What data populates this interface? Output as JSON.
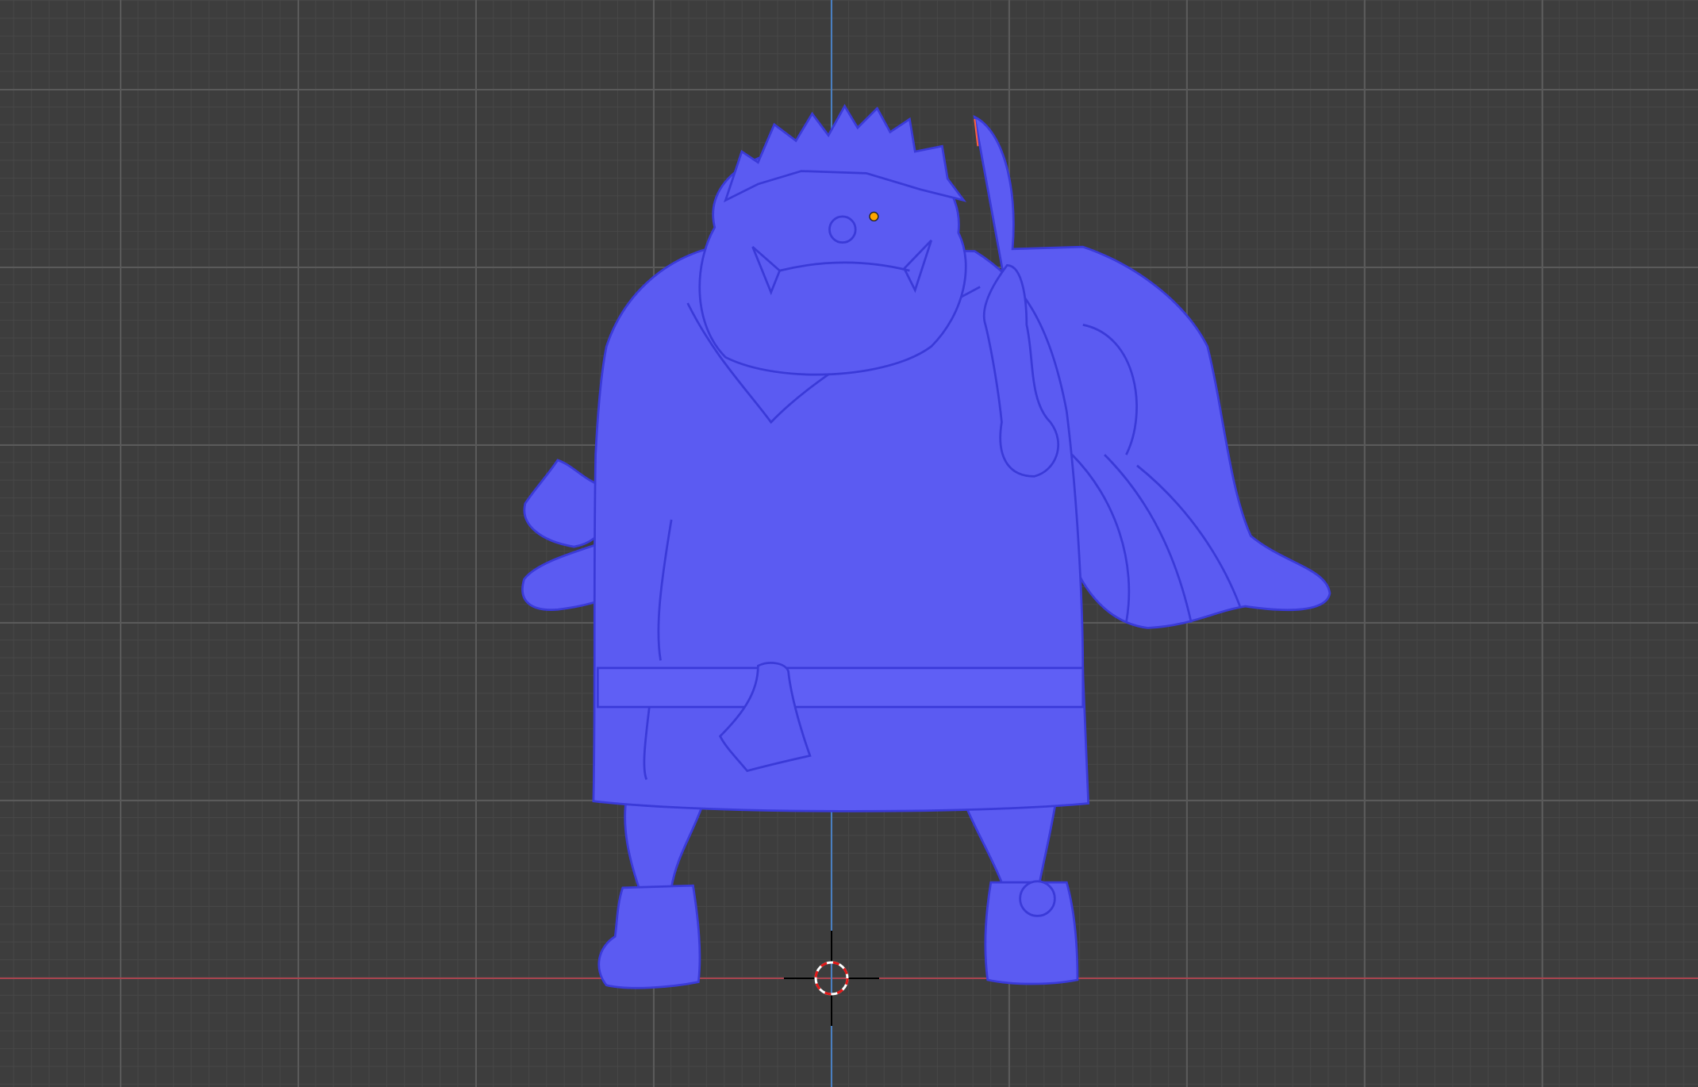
{
  "viewport": {
    "background_color": "#3d3d3d",
    "x_axis_color": "#a8444f",
    "y_axis_color": "#4a7fc0",
    "model_color": "#5b5bf2",
    "model_shadow_color": "#3a3ad8"
  },
  "icons": {
    "cursor": "3d-cursor-icon",
    "origin": "object-origin-icon"
  }
}
